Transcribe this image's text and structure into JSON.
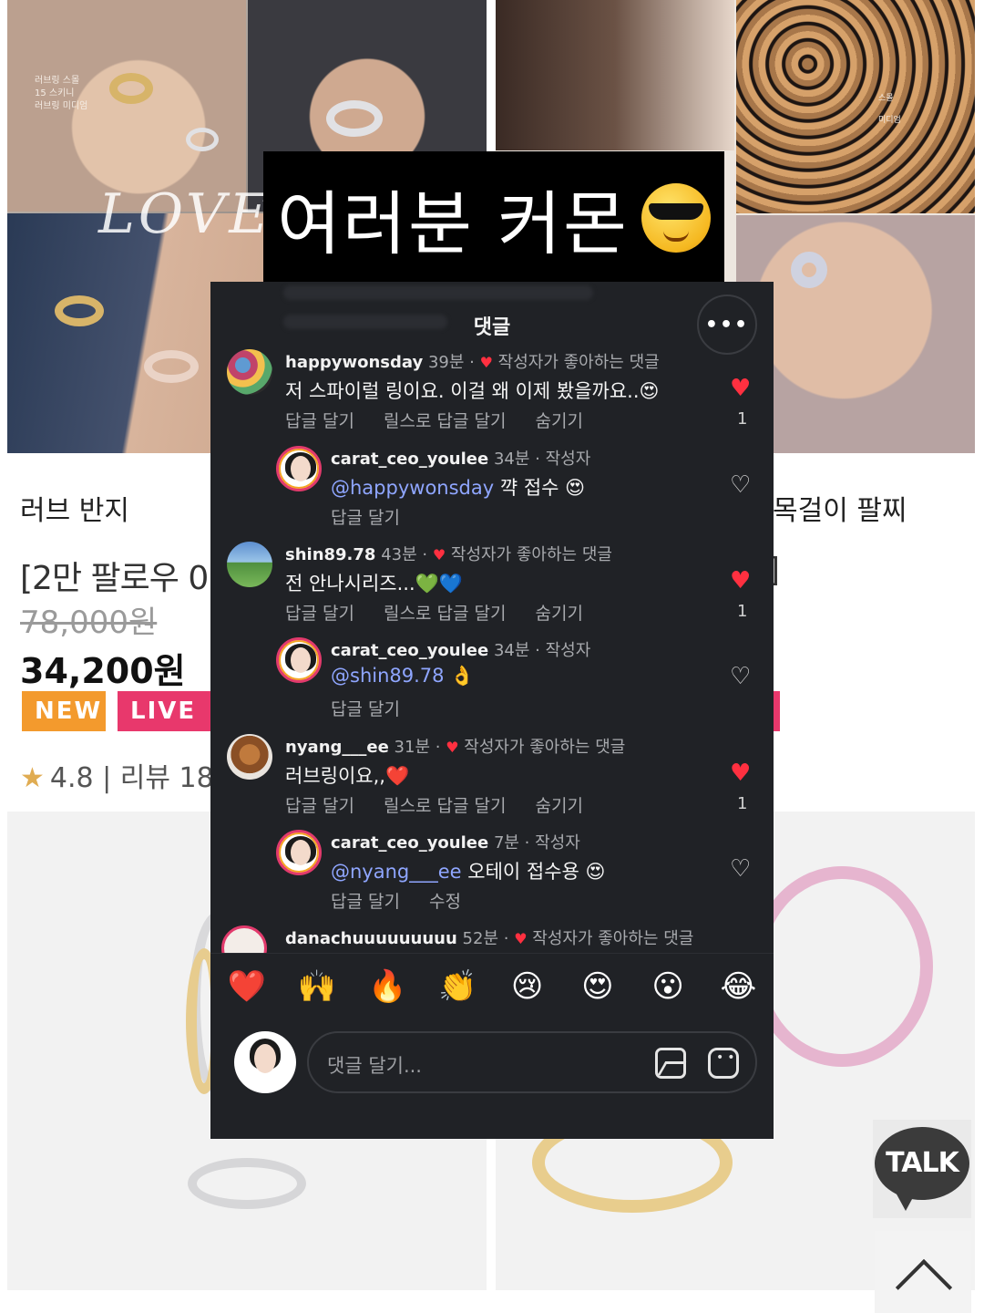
{
  "shop": {
    "photo_left_caption": [
      "러브링 스몰",
      "15 스키니",
      "러브링 미디엄"
    ],
    "photo_left_overlay": "LOVE",
    "photo_right_caption": [
      "스몰",
      "미디엄"
    ],
    "product_left_name": "러브 반지",
    "product_right_name": "목걸이 팔찌",
    "product_title": "[2만 팔로우 0",
    "product_title_right": "]",
    "old_price": "78,000원",
    "price": "34,200원",
    "badge_new": "NEW",
    "badge_live": "LIVE",
    "rating": "4.8 | 리뷰 18"
  },
  "banner": {
    "text": "여러분 커몬"
  },
  "sheet": {
    "title": "댓글",
    "more": "•••",
    "comments": [
      {
        "user": "happywonsday",
        "time": "39분",
        "meta_tail": "작성자가 좋아하는 댓글",
        "text": "저 스파이럴 링이요. 이걸 왜 이제 봤을까요..😍",
        "actions": [
          "답글 달기",
          "릴스로 답글 달기",
          "숨기기"
        ],
        "likes": "1"
      },
      {
        "user": "carat_ceo_youlee",
        "time": "34분",
        "meta_tail": "작성자",
        "mention": "@happywonsday",
        "text": " 꺅 접수 😍",
        "actions": [
          "답글 달기"
        ]
      },
      {
        "user": "shin89.78",
        "time": "43분",
        "meta_tail": "작성자가 좋아하는 댓글",
        "text": "전 안나시리즈...💚💙",
        "actions": [
          "답글 달기",
          "릴스로 답글 달기",
          "숨기기"
        ],
        "likes": "1"
      },
      {
        "user": "carat_ceo_youlee",
        "time": "34분",
        "meta_tail": "작성자",
        "mention": "@shin89.78",
        "text": " 👌",
        "actions": [
          "답글 달기"
        ]
      },
      {
        "user": "nyang___ee",
        "time": "31분",
        "meta_tail": "작성자가 좋아하는 댓글",
        "text": "러브링이요,,❤️",
        "actions": [
          "답글 달기",
          "릴스로 답글 달기",
          "숨기기"
        ],
        "likes": "1"
      },
      {
        "user": "carat_ceo_youlee",
        "time": "7분",
        "meta_tail": "작성자",
        "mention": "@nyang___ee",
        "text": " 오테이 접수용 😍",
        "actions": [
          "답글 달기",
          "수정"
        ]
      },
      {
        "user": "danachuuuuuuuuu",
        "time": "52분",
        "meta_tail": "작성자가 좋아하는 댓글"
      }
    ],
    "emojis": [
      "❤️",
      "🙌",
      "🔥",
      "👏",
      "😢",
      "😍",
      "😮",
      "😂"
    ],
    "input_placeholder": "댓글 달기..."
  },
  "floating": {
    "talk_label": "TALK"
  },
  "colors": {
    "sheet_bg": "#202226",
    "like_red": "#ff3040",
    "mention_blue": "#8fa6ff",
    "badge_new": "#f39a2d",
    "badge_live": "#e8386c"
  }
}
